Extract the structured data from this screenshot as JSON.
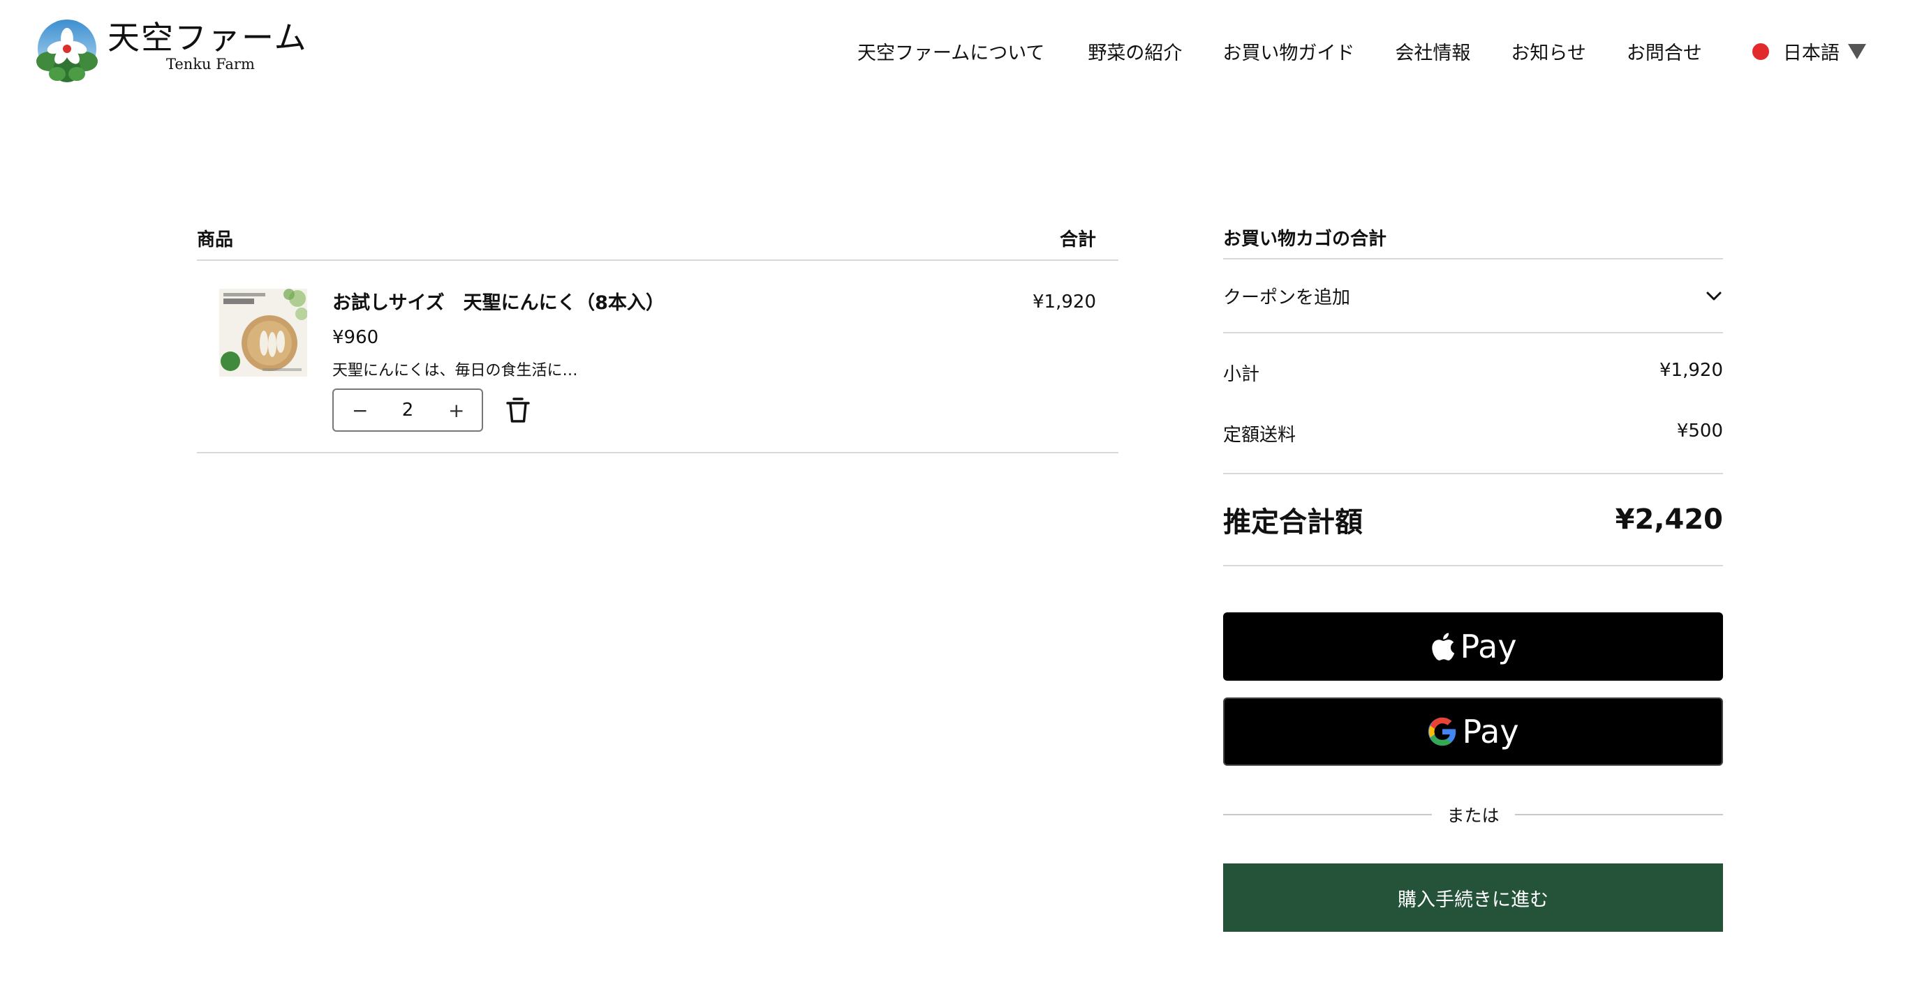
{
  "header": {
    "logo_jp": "天空ファーム",
    "logo_en": "Tenku Farm",
    "nav": [
      "天空ファームについて",
      "野菜の紹介",
      "お買い物ガイド",
      "会社情報",
      "お知らせ",
      "お問合せ"
    ],
    "language": "日本語"
  },
  "cart": {
    "col_product": "商品",
    "col_total": "合計",
    "items": [
      {
        "name": "お試しサイズ　天聖にんにく（8本入）",
        "price": "¥960",
        "description": "天聖にんにくは、毎日の食生活に…",
        "quantity": "2",
        "line_total": "¥1,920",
        "qty_minus": "−",
        "qty_plus": "+"
      }
    ]
  },
  "summary": {
    "title": "お買い物カゴの合計",
    "coupon": "クーポンを追加",
    "subtotal_label": "小計",
    "subtotal_value": "¥1,920",
    "shipping_label": "定額送料",
    "shipping_value": "¥500",
    "estimated_label": "推定合計額",
    "estimated_value": "¥2,420",
    "apple_pay": "Pay",
    "google_pay": "Pay",
    "or": "または",
    "checkout": "購入手続きに進む"
  },
  "colors": {
    "checkout_bg": "#24533a",
    "lang_dot": "#e32a2a"
  }
}
